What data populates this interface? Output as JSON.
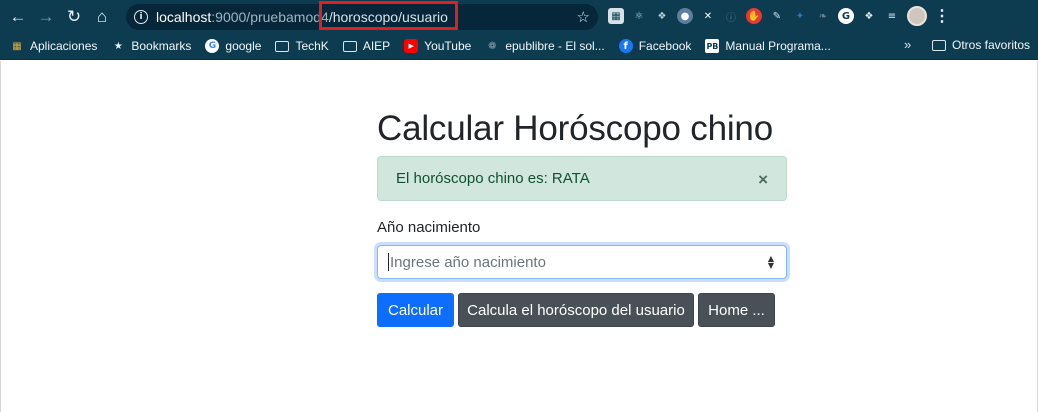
{
  "browser": {
    "url_host": "localhost",
    "url_port_path": ":9000/pruebamod4",
    "url_highlight": "/horoscopo/usuario",
    "bookmarks": [
      {
        "label": "Aplicaciones",
        "icon": "apps-grid-icon",
        "color": "#e0b03a"
      },
      {
        "label": "Bookmarks",
        "icon": "star-icon",
        "color": "#e8f1f5"
      },
      {
        "label": "google",
        "icon": "google-icon",
        "color": "#ffffff"
      },
      {
        "label": "TechK",
        "icon": "folder-icon",
        "color": "#dbe6eb"
      },
      {
        "label": "AIEP",
        "icon": "folder-icon",
        "color": "#dbe6eb"
      },
      {
        "label": "YouTube",
        "icon": "youtube-icon",
        "color": "#ff0000"
      },
      {
        "label": "epublibre - El sol...",
        "icon": "epublibre-icon",
        "color": "#8aa0ab"
      },
      {
        "label": "Facebook",
        "icon": "facebook-icon",
        "color": "#1877f2"
      },
      {
        "label": "Manual Programa...",
        "icon": "pb-icon",
        "color": "#ffffff"
      }
    ],
    "more_label": "»",
    "other_favorites": "Otros favoritos"
  },
  "page": {
    "title": "Calcular Horóscopo chino",
    "alert_text": "El horóscopo chino es: RATA",
    "alert_close": "×",
    "year_label": "Año nacimiento",
    "year_placeholder": "Ingrese año nacimiento",
    "btn_calcular": "Calcular",
    "btn_usuario": "Calcula el horóscopo del usuario",
    "btn_home": "Home ..."
  },
  "colors": {
    "chrome": "#0d3b4f",
    "primary": "#0d6efd",
    "secondary": "#495057",
    "alert_bg": "#d1e7dd"
  }
}
